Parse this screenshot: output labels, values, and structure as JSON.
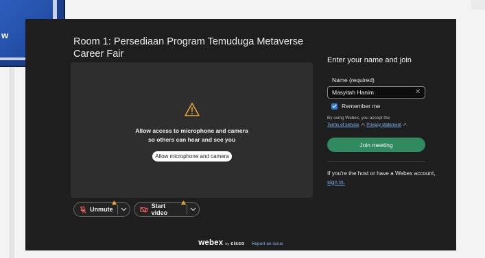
{
  "corner_window": {
    "text": "w"
  },
  "meeting": {
    "title": "Room 1: Persediaan Program Temuduga Metaverse Career Fair"
  },
  "preview": {
    "message_line1": "Allow access to microphone and camera",
    "message_line2": "so others can hear and see you",
    "allow_button": "Allow microphone and camera"
  },
  "controls": {
    "unmute_label": "Unmute",
    "start_video_label": "Start video"
  },
  "join": {
    "heading": "Enter your name and join",
    "name_label": "Name (required)",
    "name_value": "Masyitah Hanim",
    "remember_label": "Remember me",
    "terms_prefix": "By using Webex, you accept the",
    "terms_of_service": "Terms of service",
    "terms_separator": ", ",
    "privacy_statement": "Privacy statement",
    "terms_suffix": ".",
    "join_button": "Join meeting",
    "host_text": "If you're the host or have a Webex account,",
    "sign_in": "sign in."
  },
  "footer": {
    "logo_word": "webex",
    "logo_by": "by",
    "logo_cisco": "cisco",
    "report_link": "Report an issue"
  },
  "colors": {
    "panel_bg": "#1e1e1e",
    "preview_bg": "#2e2e2e",
    "join_button": "#2f8a60",
    "link": "#7fb6f2",
    "warning": "#e9a53a",
    "checkbox": "#2f7bdc"
  },
  "icons": {
    "warning": "warning-triangle-icon",
    "mic_muted": "microphone-muted-icon",
    "video_off": "video-off-icon",
    "chevron": "chevron-down-icon",
    "clear": "clear-input-icon",
    "external": "external-link-icon"
  }
}
